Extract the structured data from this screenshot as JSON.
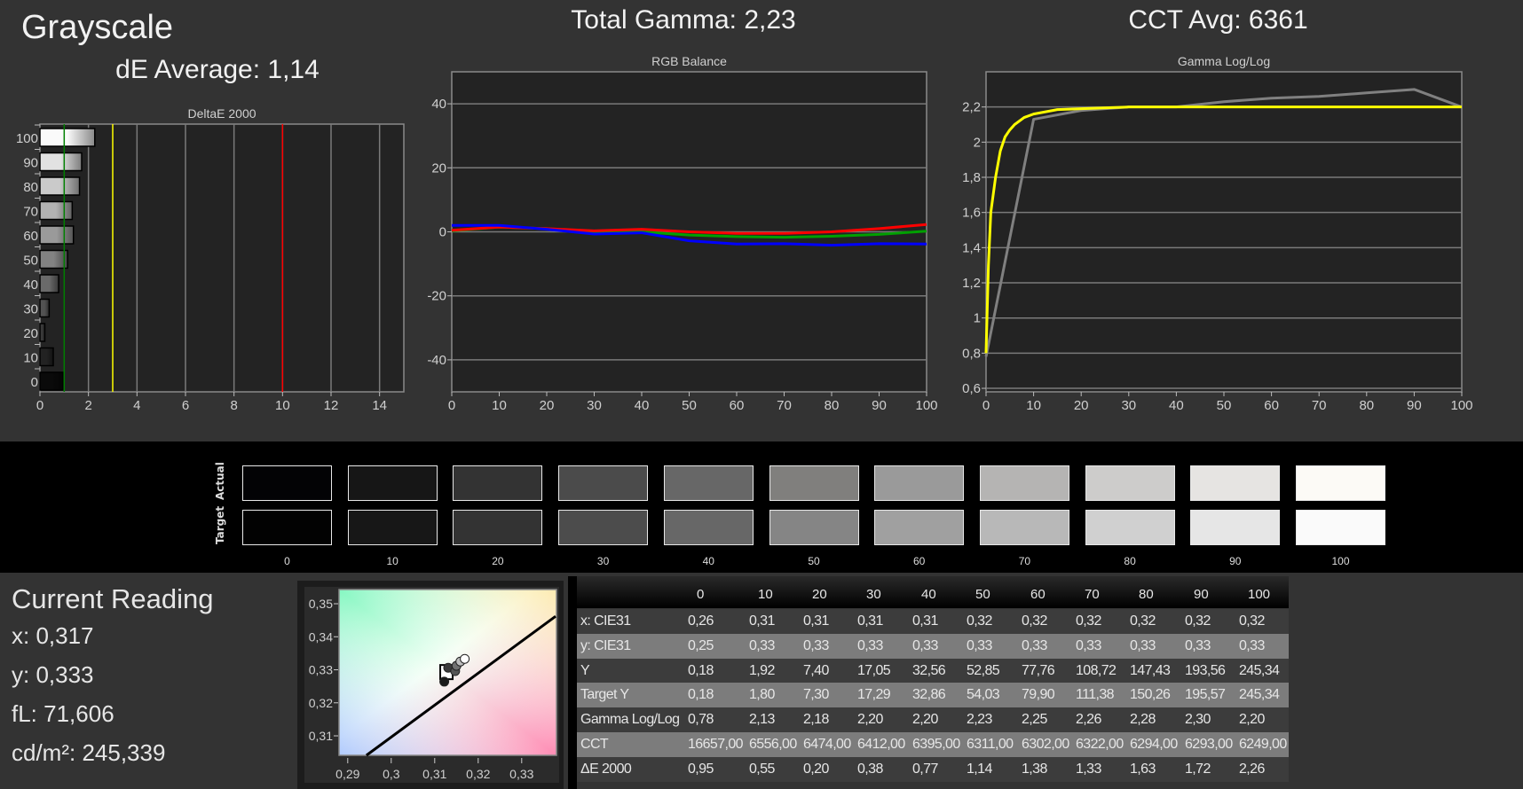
{
  "header": {
    "page_title": "Grayscale",
    "de_average": "dE Average: 1,14",
    "total_gamma": "Total Gamma: 2,23",
    "cct_avg": "CCT Avg: 6361"
  },
  "current_reading": {
    "title": "Current Reading",
    "x": "x: 0,317",
    "y": "y: 0,333",
    "fl": "fL: 71,606",
    "cdm2": "cd/m²: 245,339"
  },
  "swatches": {
    "actual_label": "Actual",
    "target_label": "Target",
    "levels": [
      "0",
      "10",
      "20",
      "30",
      "40",
      "50",
      "60",
      "70",
      "80",
      "90",
      "100"
    ],
    "actual_colors": [
      "#030305",
      "#161616",
      "#333333",
      "#4b4b4b",
      "#676767",
      "#807f7d",
      "#9a9a9a",
      "#b5b4b3",
      "#cdcccb",
      "#e6e4e2",
      "#fcfaf6"
    ],
    "target_colors": [
      "#020202",
      "#171717",
      "#333333",
      "#4c4c4c",
      "#676767",
      "#858585",
      "#a0a0a0",
      "#b8b8b8",
      "#d0d0d0",
      "#e6e6e6",
      "#fafafa"
    ]
  },
  "table": {
    "columns": [
      "0",
      "10",
      "20",
      "30",
      "40",
      "50",
      "60",
      "70",
      "80",
      "90",
      "100"
    ],
    "rows": [
      {
        "label": "x: CIE31",
        "values": [
          "0,26",
          "0,31",
          "0,31",
          "0,31",
          "0,31",
          "0,32",
          "0,32",
          "0,32",
          "0,32",
          "0,32",
          "0,32"
        ]
      },
      {
        "label": "y: CIE31",
        "values": [
          "0,25",
          "0,33",
          "0,33",
          "0,33",
          "0,33",
          "0,33",
          "0,33",
          "0,33",
          "0,33",
          "0,33",
          "0,33"
        ]
      },
      {
        "label": "Y",
        "values": [
          "0,18",
          "1,92",
          "7,40",
          "17,05",
          "32,56",
          "52,85",
          "77,76",
          "108,72",
          "147,43",
          "193,56",
          "245,34"
        ]
      },
      {
        "label": "Target Y",
        "values": [
          "0,18",
          "1,80",
          "7,30",
          "17,29",
          "32,86",
          "54,03",
          "79,90",
          "111,38",
          "150,26",
          "195,57",
          "245,34"
        ]
      },
      {
        "label": "Gamma Log/Log",
        "values": [
          "0,78",
          "2,13",
          "2,18",
          "2,20",
          "2,20",
          "2,23",
          "2,25",
          "2,26",
          "2,28",
          "2,30",
          "2,20"
        ]
      },
      {
        "label": "CCT",
        "values": [
          "16657,00",
          "6556,00",
          "6474,00",
          "6412,00",
          "6395,00",
          "6311,00",
          "6302,00",
          "6322,00",
          "6294,00",
          "6293,00",
          "6249,00"
        ]
      },
      {
        "label": "ΔE 2000",
        "values": [
          "0,95",
          "0,55",
          "0,20",
          "0,38",
          "0,77",
          "1,14",
          "1,38",
          "1,33",
          "1,63",
          "1,72",
          "2,26"
        ]
      }
    ]
  },
  "chart_data": [
    {
      "type": "bar",
      "orientation": "horizontal",
      "title": "DeltaE 2000",
      "categories": [
        "100",
        "90",
        "80",
        "70",
        "60",
        "50",
        "40",
        "30",
        "20",
        "10",
        "0"
      ],
      "values": [
        2.26,
        1.72,
        1.63,
        1.33,
        1.38,
        1.14,
        0.77,
        0.38,
        0.2,
        0.55,
        0.95
      ],
      "xlim": [
        0,
        15
      ],
      "xticks": [
        "0",
        "2",
        "4",
        "6",
        "8",
        "10",
        "12",
        "14"
      ],
      "threshold_lines": [
        {
          "value": 1,
          "color": "#008000"
        },
        {
          "value": 3,
          "color": "#ffff00"
        },
        {
          "value": 10,
          "color": "#ff0000"
        }
      ],
      "grid": true
    },
    {
      "type": "line",
      "title": "RGB Balance",
      "x": [
        0,
        10,
        20,
        30,
        40,
        50,
        60,
        70,
        80,
        90,
        100
      ],
      "ylim": [
        -50,
        50
      ],
      "yticks": [
        "40",
        "20",
        "0",
        "-20",
        "-40"
      ],
      "xticks": [
        "0",
        "10",
        "20",
        "30",
        "40",
        "50",
        "60",
        "70",
        "80",
        "90",
        "100"
      ],
      "series": [
        {
          "color": "#00a000",
          "values": [
            0.3,
            1.5,
            1.0,
            0.0,
            0.0,
            -1.0,
            -1.5,
            -1.7,
            -1.4,
            -0.8,
            0.2
          ]
        },
        {
          "color": "#ff0000",
          "values": [
            0.5,
            1.5,
            1.0,
            0.3,
            0.8,
            0.0,
            -0.5,
            -0.5,
            0.0,
            1.0,
            2.3
          ]
        },
        {
          "color": "#0000ff",
          "values": [
            2.0,
            2.0,
            0.8,
            -0.7,
            -0.3,
            -2.8,
            -3.8,
            -3.7,
            -4.2,
            -3.7,
            -3.8
          ]
        }
      ],
      "grid": true
    },
    {
      "type": "line",
      "title": "Gamma Log/Log",
      "xlim": [
        0,
        100
      ],
      "ylim": [
        0.58,
        2.4
      ],
      "yticks": [
        "2,2",
        "2",
        "1,8",
        "1,6",
        "1,4",
        "1,2",
        "1",
        "0,8",
        "0,6"
      ],
      "xticks": [
        "0",
        "10",
        "20",
        "30",
        "40",
        "50",
        "60",
        "70",
        "80",
        "90",
        "100"
      ],
      "series": [
        {
          "color": "#808080",
          "x": [
            0,
            10,
            20,
            30,
            40,
            50,
            60,
            70,
            80,
            90,
            100
          ],
          "values": [
            0.78,
            2.13,
            2.18,
            2.2,
            2.2,
            2.23,
            2.25,
            2.26,
            2.28,
            2.3,
            2.2
          ]
        },
        {
          "color": "#ffff00",
          "x": [
            0,
            0.5,
            1,
            2,
            3,
            4,
            5,
            6,
            8,
            10,
            15,
            20,
            30,
            100
          ],
          "values": [
            0.8,
            1.3,
            1.6,
            1.8,
            1.95,
            2.03,
            2.07,
            2.1,
            2.14,
            2.16,
            2.185,
            2.19,
            2.2,
            2.2
          ]
        }
      ],
      "grid": true
    },
    {
      "type": "scatter",
      "title": "",
      "xlim": [
        0.288,
        0.338
      ],
      "ylim": [
        0.3041,
        0.3543
      ],
      "xticks": [
        "0,29",
        "0,3",
        "0,31",
        "0,32",
        "0,33"
      ],
      "yticks": [
        "0,35",
        "0,34",
        "0,33",
        "0,32",
        "0,31"
      ],
      "target_point": {
        "x": 0.3127,
        "y": 0.3293
      },
      "points": [
        {
          "x": 0.3122,
          "y": 0.3264,
          "color": "#1a1a1a"
        },
        {
          "x": 0.3131,
          "y": 0.3306,
          "color": "#3a3a3a"
        },
        {
          "x": 0.3147,
          "y": 0.3296,
          "color": "#555555"
        },
        {
          "x": 0.315,
          "y": 0.3312,
          "color": "#707070"
        },
        {
          "x": 0.3159,
          "y": 0.3325,
          "color": "#bdbdbd"
        },
        {
          "x": 0.3169,
          "y": 0.3333,
          "color": "#ffffff"
        }
      ],
      "planckian_locus": [
        {
          "x": 0.2943,
          "y": 0.3041
        },
        {
          "x": 0.3378,
          "y": 0.3462
        }
      ]
    }
  ]
}
